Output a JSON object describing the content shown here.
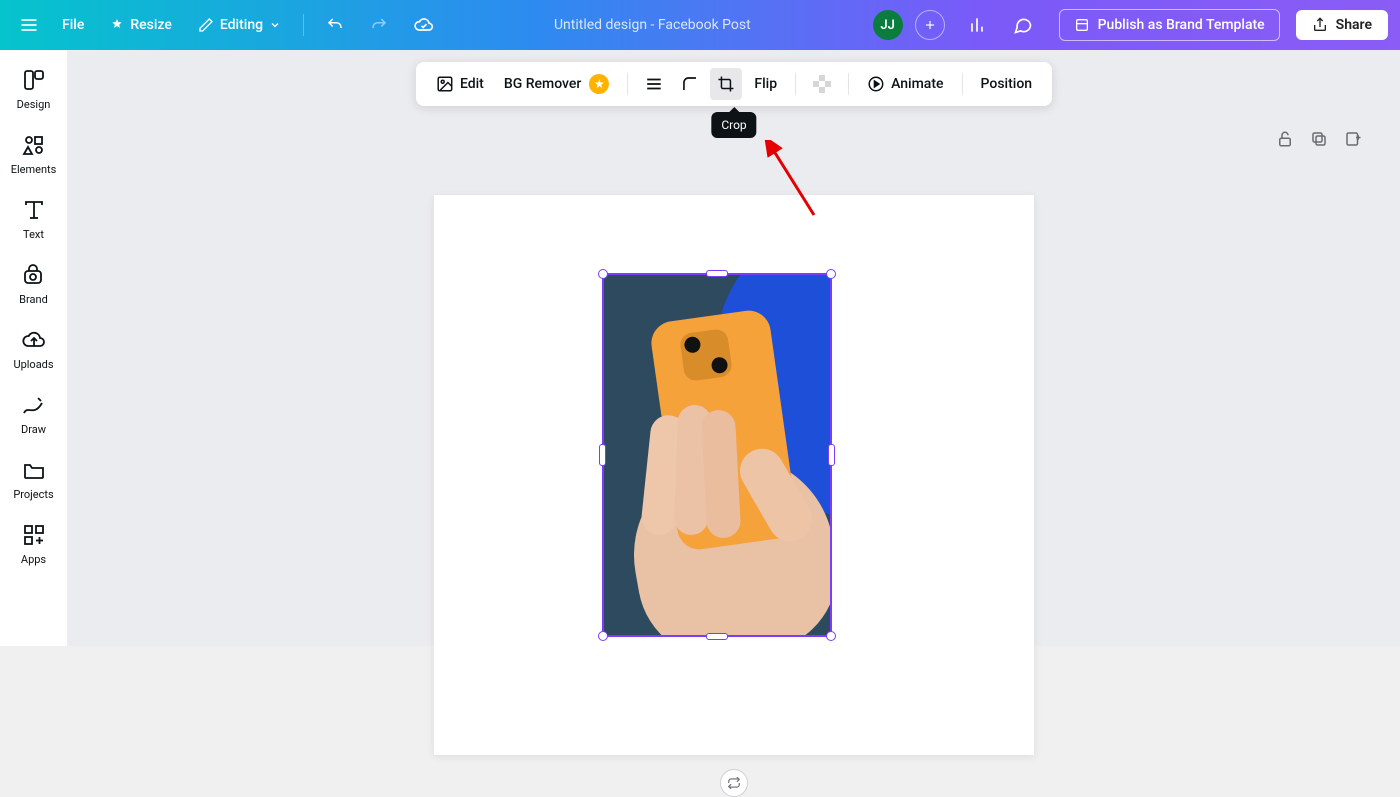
{
  "topbar": {
    "file": "File",
    "resize": "Resize",
    "editing": "Editing",
    "doc_title": "Untitled design - Facebook Post",
    "avatar_initials": "JJ",
    "publish": "Publish as Brand Template",
    "share": "Share"
  },
  "sidebar": {
    "design": "Design",
    "elements": "Elements",
    "text": "Text",
    "brand": "Brand",
    "uploads": "Uploads",
    "draw": "Draw",
    "projects": "Projects",
    "apps": "Apps"
  },
  "context_toolbar": {
    "edit": "Edit",
    "bg_remover": "BG Remover",
    "flip": "Flip",
    "animate": "Animate",
    "position": "Position"
  },
  "tooltip": {
    "crop": "Crop"
  }
}
